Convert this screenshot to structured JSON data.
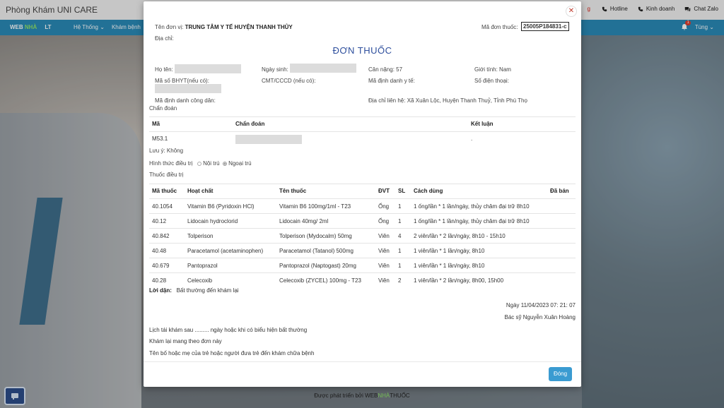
{
  "app": {
    "brand": "Phòng Khám UNI CARE",
    "top_links": {
      "partial": "g",
      "hotline": "Hotline",
      "business": "Kinh doanh",
      "chat": "Chat Zalo"
    },
    "nav": {
      "logo_a": "WEB ",
      "logo_b": "NHÀ",
      "logo_c": "LT",
      "menu": [
        "Hệ Thống",
        "Khám bệnh"
      ],
      "notif_count": "1",
      "user": "Tùng"
    },
    "footer": {
      "prefix": "Được phát triển bởi ",
      "brand_a": "WEB",
      "brand_b": "NHÀ",
      "brand_c": "THUỐC"
    }
  },
  "modal": {
    "unit_label": "Tên đơn vị:",
    "unit_value": "TRUNG TÂM Y TẾ HUYỆN THANH THỦY",
    "code_label": "Mã đơn thuốc:",
    "code_value": "25005P184831-c",
    "address_label": "Địa chỉ:",
    "title": "ĐƠN THUỐC",
    "patient": {
      "name_label": "Họ tên:",
      "dob_label": "Ngày sinh:",
      "weight_label": "Cân nặng:",
      "weight_value": "57",
      "gender_label": "Giới tính:",
      "gender_value": "Nam",
      "bhyt_label": "Mã số BHYT(nếu có):",
      "cccd_label": "CMT/CCCD (nếu có):",
      "health_id_label": "Mã định danh y tế:",
      "phone_label": "Số điện thoại:",
      "citizen_id_label": "Mã định danh công dân:",
      "contact_label": "Địa chỉ liên hệ:",
      "contact_value": "Xã Xuân Lộc, Huyện Thanh Thuỷ, Tỉnh Phú Thọ"
    },
    "diagnosis_section": "Chẩn đoán",
    "diag_headers": {
      "code": "Mã",
      "diagnosis": "Chẩn đoán",
      "conclusion": "Kết luận"
    },
    "diag_row": {
      "code": "M53.1",
      "conclusion": "."
    },
    "note": "Lưu ý: Không",
    "treatment": {
      "label": "Hình thức điều trị",
      "inpatient": "Nội trú",
      "outpatient": "Ngoại trú"
    },
    "drugs_section": "Thuốc điều trị",
    "drug_headers": {
      "code": "Mã thuốc",
      "ingredient": "Hoạt chất",
      "name": "Tên thuốc",
      "unit": "ĐVT",
      "qty": "SL",
      "usage": "Cách dùng",
      "sold": "Đã bán"
    },
    "drugs": [
      {
        "code": "40.1054",
        "ingredient": "Vitamin B6 (Pyridoxin HCl)",
        "name": "Vitamin B6 100mg/1ml - T23",
        "unit": "Ống",
        "qty": "1",
        "usage": "1 ống/lần * 1 lần/ngày, thủy châm đại trữ 8h10"
      },
      {
        "code": "40.12",
        "ingredient": "Lidocain hydroclorid",
        "name": "Lidocain 40mg/ 2ml",
        "unit": "Ống",
        "qty": "1",
        "usage": "1 ống/lần * 1 lần/ngày, thủy châm đại trữ 8h10"
      },
      {
        "code": "40.842",
        "ingredient": "Tolperison",
        "name": "Tolperison (Mydocalm) 50mg",
        "unit": "Viên",
        "qty": "4",
        "usage": "2 viên/lần * 2 lần/ngày, 8h10 - 15h10"
      },
      {
        "code": "40.48",
        "ingredient": "Paracetamol (acetaminophen)",
        "name": "Paracetamol (Tatanol) 500mg",
        "unit": "Viên",
        "qty": "1",
        "usage": "1 viên/lần * 1 lần/ngày, 8h10"
      },
      {
        "code": "40.679",
        "ingredient": "Pantoprazol",
        "name": "Pantoprazol (Naptogast) 20mg",
        "unit": "Viên",
        "qty": "1",
        "usage": "1 viên/lần * 1 lần/ngày, 8h10"
      },
      {
        "code": "40.28",
        "ingredient": "Celecoxib",
        "name": "Celecoxib (ZYCEL) 100mg - T23",
        "unit": "Viên",
        "qty": "2",
        "usage": "1 viên/lần * 2 lần/ngày, 8h00, 15h00"
      }
    ],
    "advice_label": "Lời dặn:",
    "advice_value": "Bất thường đến khám lại",
    "date": "Ngày 11/04/2023 07: 21: 07",
    "doctor": "Bác sỹ Nguyễn Xuân Hoàng",
    "footnotes": [
      "Lịch tái khám sau ......... ngày hoặc khi có biểu hiện bất thường",
      "Khám lại mang theo đơn này",
      "Tên bố hoặc mẹ của trẻ hoặc người đưa trẻ đến khám chữa bệnh"
    ],
    "close_button": "Đóng"
  }
}
